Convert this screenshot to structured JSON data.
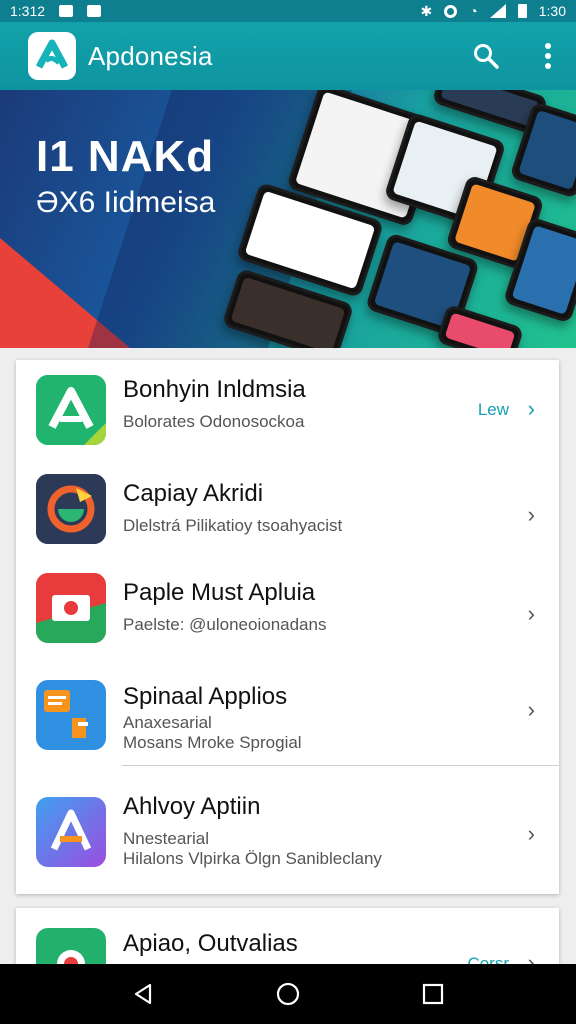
{
  "status_bar": {
    "time_left": "1:312",
    "time_right": "1:30"
  },
  "app_bar": {
    "title": "Apdonesia"
  },
  "banner": {
    "heading": "I1 NAKd",
    "subheading": "ƏX6 Iidmeisa"
  },
  "list": [
    {
      "title": "Bonhyin Inldmsia",
      "subtitle": "Bolorates Odonosockoa",
      "badge": "Lew",
      "icon": "blue-green-a-app-icon"
    },
    {
      "title": "Capiay Akridi",
      "subtitle": "Dlelstrá Pilikatioy tsoahyacist",
      "icon": "globe-app-icon"
    },
    {
      "title": "Paple Must Apluia",
      "subtitle": "Paelste: @uloneoionadans",
      "icon": "red-orange-app-icon"
    },
    {
      "title": "Spinaal Applios",
      "subtitle": "Anaxesarial",
      "subtitle2": "Mosans Mroke Sprogial",
      "icon": "blue-document-app-icon"
    },
    {
      "title": "Ahlvoy Aptiin",
      "subtitle": "Nnestearial",
      "subtitle2": "Hilalons Vlpirka Ölgn Sanibleclany",
      "icon": "purple-gradient-a-app-icon"
    }
  ],
  "partial_item": {
    "title": "Apiao, Outvalias",
    "badge": "Corsr"
  },
  "colors": {
    "primary": "#13a2ab",
    "accent": "#16a0b0",
    "nav": "#000000"
  }
}
